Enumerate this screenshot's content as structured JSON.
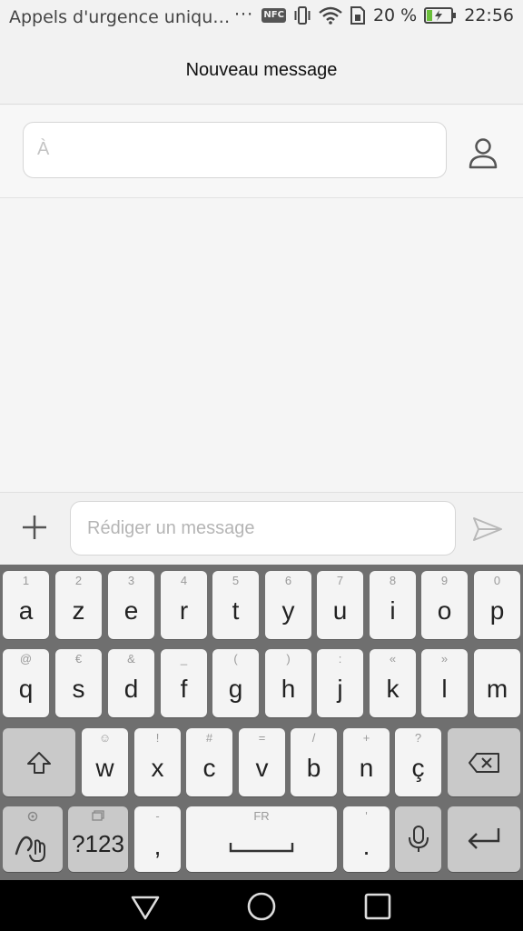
{
  "status_bar": {
    "notification_text": "Appels d'urgence uniqu…",
    "overflow": "···",
    "nfc_label": "NFC",
    "battery_percent": "20 %",
    "time": "22:56",
    "icons": [
      "nfc-icon",
      "vibrate-icon",
      "wifi-icon",
      "sim-icon",
      "battery-charging-icon"
    ]
  },
  "header": {
    "title": "Nouveau message"
  },
  "recipient": {
    "placeholder": "À",
    "contact_icon": "person-icon"
  },
  "compose": {
    "placeholder": "Rédiger un message",
    "add_icon": "plus-icon",
    "send_icon": "send-icon"
  },
  "keyboard": {
    "row1": [
      {
        "main": "a",
        "sub": "1"
      },
      {
        "main": "z",
        "sub": "2"
      },
      {
        "main": "e",
        "sub": "3"
      },
      {
        "main": "r",
        "sub": "4"
      },
      {
        "main": "t",
        "sub": "5"
      },
      {
        "main": "y",
        "sub": "6"
      },
      {
        "main": "u",
        "sub": "7"
      },
      {
        "main": "i",
        "sub": "8"
      },
      {
        "main": "o",
        "sub": "9"
      },
      {
        "main": "p",
        "sub": "0"
      }
    ],
    "row2": [
      {
        "main": "q",
        "sub": "@"
      },
      {
        "main": "s",
        "sub": "€"
      },
      {
        "main": "d",
        "sub": "&"
      },
      {
        "main": "f",
        "sub": "_"
      },
      {
        "main": "g",
        "sub": "("
      },
      {
        "main": "h",
        "sub": ")"
      },
      {
        "main": "j",
        "sub": ":"
      },
      {
        "main": "k",
        "sub": "«"
      },
      {
        "main": "l",
        "sub": "»"
      },
      {
        "main": "m",
        "sub": ""
      }
    ],
    "row3": [
      {
        "main": "w",
        "sub": "☺"
      },
      {
        "main": "x",
        "sub": "!"
      },
      {
        "main": "c",
        "sub": "#"
      },
      {
        "main": "v",
        "sub": "="
      },
      {
        "main": "b",
        "sub": "/"
      },
      {
        "main": "n",
        "sub": "+"
      },
      {
        "main": "ç",
        "sub": "?"
      }
    ],
    "row4": {
      "symbols_label": "?123",
      "comma": ",",
      "comma_sub": "-",
      "space_sub": "FR",
      "period": ".",
      "period_sub": "'"
    }
  },
  "nav_bar": {
    "icons": [
      "back-icon",
      "home-icon",
      "recents-icon"
    ]
  },
  "colors": {
    "keyboard_bg": "#6f6f6f",
    "key_light": "#f4f4f4",
    "key_dark": "#c9c9c9",
    "app_bg": "#f5f5f5"
  }
}
